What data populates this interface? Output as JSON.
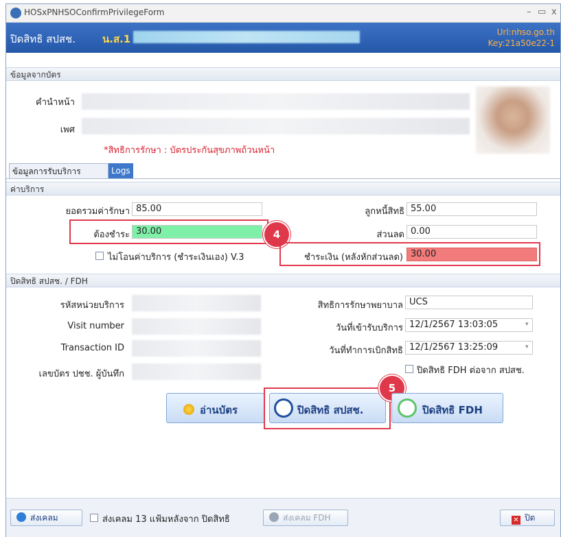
{
  "window": {
    "title": "HOSxPNHSOConfirmPrivilegeForm",
    "minimize": "–",
    "maximize": "▭",
    "close": "x"
  },
  "header": {
    "title": "ปิดสิทธิ สปสช.",
    "patient_prefix": "น.ส.1",
    "url_line": "Url:nhso.go.th",
    "key_line": "Key:21a50e22-1"
  },
  "card_section": {
    "title": "ข้อมูลจากบัตร",
    "prefix_label": "คำนำหน้า",
    "sex_label": "เพศ",
    "rights_text": "*สิทธิการรักษา : บัตรประกันสุขภาพถ้วนหน้า"
  },
  "tabs": [
    {
      "label": "ข้อมูลการรับบริการ"
    },
    {
      "label": "Logs"
    }
  ],
  "charges": {
    "title": "ค่าบริการ",
    "total_label": "ยอดรวมค่ารักษา",
    "total_value": "85.00",
    "debtor_label": "ลูกหนี้สิทธิ",
    "debtor_value": "55.00",
    "must_pay_label": "ต้องชำระ",
    "must_pay_value": "30.00",
    "discount_label": "ส่วนลด",
    "discount_value": "0.00",
    "no_transfer_label": "ไม่โอนค่าบริการ (ชำระเงินเอง) V.3",
    "paid_label": "ชำระเงิน (หลังหักส่วนลด)",
    "paid_value": "30.00"
  },
  "close_section": {
    "title": "ปิดสิทธิ สปสช. / FDH",
    "unit_code_label": "รหัสหน่วยบริการ",
    "visit_number_label": "Visit number",
    "transaction_id_label": "Transaction ID",
    "recorder_id_label": "เลขบัตร ปชช. ผู้บันทึก",
    "right_label": "สิทธิการรักษาพยาบาล",
    "right_value": "UCS",
    "service_date_label": "วันที่เข้ารับบริการ",
    "service_date_value": "12/1/2567 13:03:05",
    "claim_date_label": "วันที่ทำการเบิกสิทธิ",
    "claim_date_value": "12/1/2567 13:25:09",
    "fdh_after_label": "ปิดสิทธิ FDH ต่อจาก สปสช."
  },
  "buttons": {
    "read_card": "อ่านบัตร",
    "close_nhso": "ปิดสิทธิ สปสช.",
    "close_fdh": "ปิดสิทธิ FDH"
  },
  "callouts": {
    "badge4": "4",
    "badge5": "5"
  },
  "footer": {
    "send_claim": "ส่งเคลม",
    "send_13_label": "ส่งเคลม 13 แฟ้มหลังจาก ปิดสิทธิ",
    "send_fdh": "ส่งเคลม FDH",
    "close": "ปิด"
  },
  "colors": {
    "header": "#2d63b4",
    "must_pay": "#7ff0a8",
    "paid": "#f27b7b",
    "callout": "#e0384b"
  }
}
